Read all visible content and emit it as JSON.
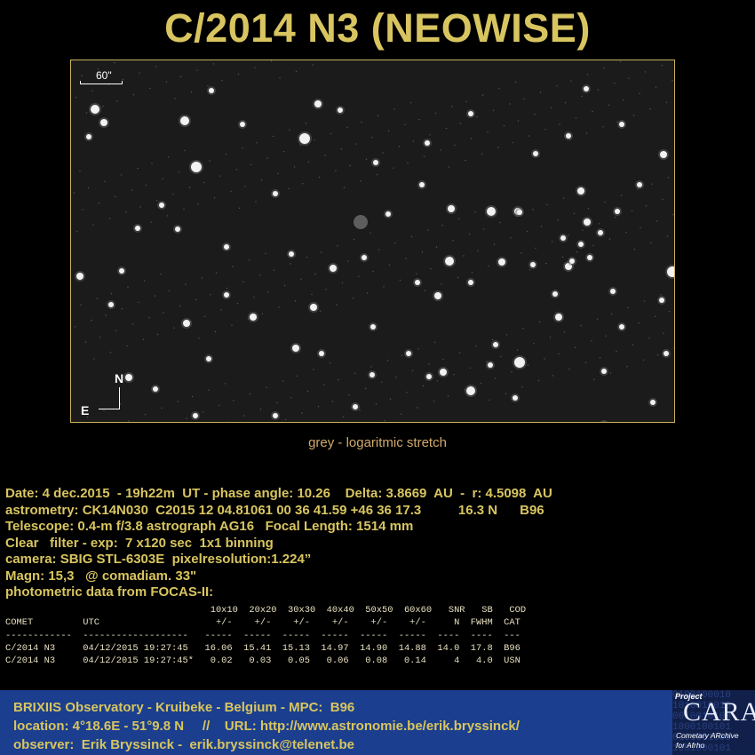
{
  "title": "C/2014 N3 (NEOWISE)",
  "image": {
    "scale_label": "60\"",
    "north_label": "N",
    "east_label": "E"
  },
  "caption": "grey - logaritmic stretch",
  "info_lines": [
    "Date: 4 dec.2015  - 19h22m  UT - phase angle: 10.26    Delta: 3.8669  AU  -  r: 4.5098  AU",
    "astrometry: CK14N030  C2015 12 04.81061 00 36 41.59 +46 36 17.3          16.3 N      B96",
    "Telescope: 0.4-m f/3.8 astrograph AG16   Focal Length: 1514 mm",
    "Clear   filter - exp:  7 x120 sec  1x1 binning",
    "camera: SBIG STL-6303E  pixelresolution:1.224”",
    "Magn: 15,3   @ comadiam. 33\"",
    "photometric data from FOCAS-II:"
  ],
  "photometry_lines": [
    "                                     10x10  20x20  30x30  40x40  50x50  60x60   SNR   SB   COD",
    "COMET         UTC                     +/-    +/-    +/-    +/-    +/-    +/-     N  FWHM  CAT",
    "------------  -------------------   -----  -----  -----  -----  -----  -----  ----  ----  ---",
    "C/2014 N3     04/12/2015 19:27:45   16.06  15.41  15.13  14.97  14.90  14.88  14.0  17.8  B96",
    "C/2014 N3     04/12/2015 19:27:45*   0.02   0.03   0.05   0.06   0.08   0.14     4   4.0  USN"
  ],
  "footer_lines": [
    "BRIXIIS Observatory - Kruibeke - Belgium - MPC:  B96",
    "location: 4°18.6E - 51°9.8 N     //    URL: http://www.astronomie.be/erik.bryssinck/",
    "observer:  Erik Bryssinck -  erik.bryssinck@telenet.be"
  ],
  "logo": {
    "project": "Project",
    "name": "CARA",
    "subtitle_1": "Cometary ARchive",
    "subtitle_2": "for Afrho",
    "binary": "0100100010\n1010010010\n0010010100\n1000100101\n0101001000\n1001000101"
  },
  "colors": {
    "title": "#d8c560",
    "caption": "#d2a96a",
    "footer_bg": "#1b3f8e",
    "frame": "#c9b25a"
  }
}
